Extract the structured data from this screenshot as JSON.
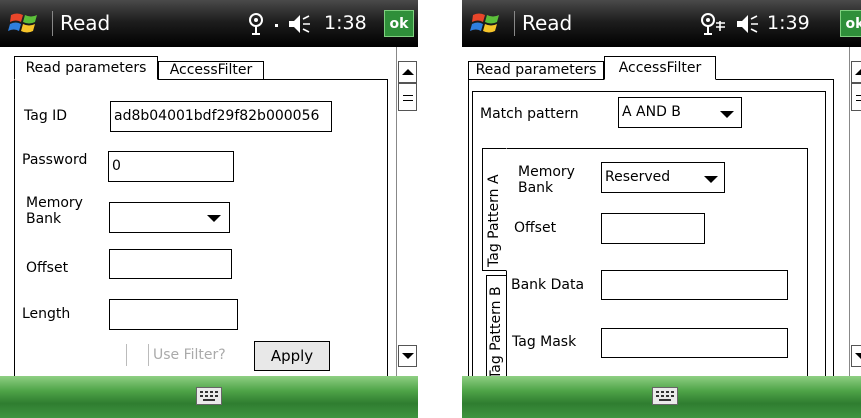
{
  "colors": {
    "titlebar": "#000000",
    "bottombar": "#3f9540",
    "ok_button": "#2f8f3a"
  },
  "screen1": {
    "title": "Read",
    "status_icons": [
      "connectivity-icon",
      "speaker-icon"
    ],
    "time": "1:38",
    "ok_label": "ok",
    "tabs": [
      {
        "label": "Read parameters",
        "active": true
      },
      {
        "label": "AccessFilter",
        "active": false
      }
    ],
    "fields": {
      "tag_id_label": "Tag ID",
      "tag_id_value": "ad8b04001bdf29f82b000056",
      "password_label": "Password",
      "password_value": "0",
      "memory_bank_label_1": "Memory",
      "memory_bank_label_2": "Bank",
      "memory_bank_value": "",
      "offset_label": "Offset",
      "offset_value": "",
      "length_label": "Length",
      "length_value": ""
    },
    "use_filter_label": "Use Filter?",
    "apply_label": "Apply"
  },
  "screen2": {
    "title": "Read",
    "status_icons": [
      "connectivity-icon",
      "speaker-icon"
    ],
    "time": "1:39",
    "ok_label": "ok",
    "tabs": [
      {
        "label": "Read parameters",
        "active": false
      },
      {
        "label": "AccessFilter",
        "active": true
      }
    ],
    "match_pattern_label": "Match pattern",
    "match_pattern_value": "A AND B",
    "vertical_tabs": [
      {
        "label": "Tag Pattern A",
        "active": true
      },
      {
        "label": "Tag Pattern B",
        "active": false
      }
    ],
    "pattern_fields": {
      "memory_bank_label_1": "Memory",
      "memory_bank_label_2": "Bank",
      "memory_bank_value": "Reserved",
      "offset_label": "Offset",
      "offset_value": "",
      "bank_data_label": "Bank Data",
      "bank_data_value": "",
      "tag_mask_label": "Tag Mask",
      "tag_mask_value": ""
    }
  }
}
